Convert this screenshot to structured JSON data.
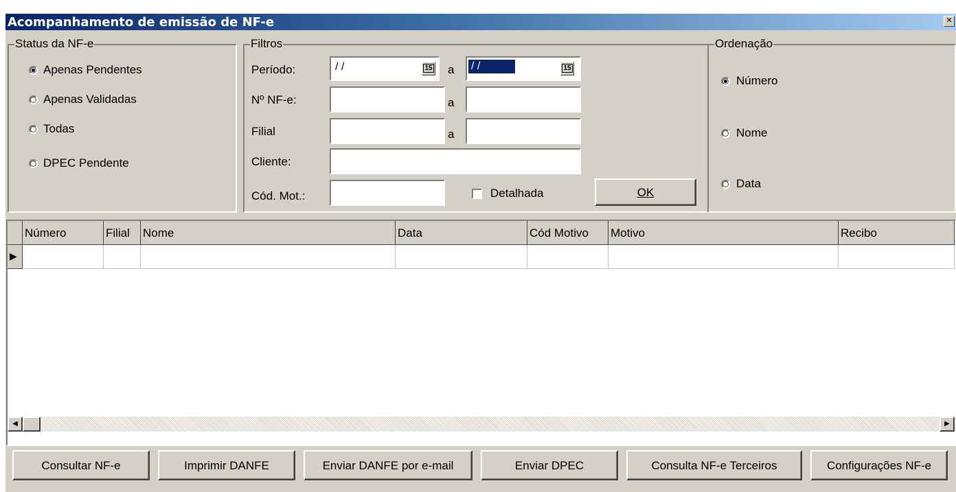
{
  "window": {
    "title": "Acompanhamento de emissão de NF-e",
    "close_glyph": "✕"
  },
  "status": {
    "legend": "Status da NF-e",
    "options": [
      {
        "label": "Apenas Pendentes",
        "selected": true
      },
      {
        "label": "Apenas Validadas",
        "selected": false
      },
      {
        "label": "Todas",
        "selected": false
      },
      {
        "label": "DPEC Pendente",
        "selected": false
      }
    ]
  },
  "filtros": {
    "legend": "Filtros",
    "periodo_label": "Período:",
    "periodo_from": "/ /",
    "periodo_to": "/ /",
    "nf_label": "Nº NF-e:",
    "filial_label": "Filial",
    "cliente_label": "Cliente:",
    "codmot_label": "Cód. Mot.:",
    "sep_a": "a",
    "calendar_glyph": "15",
    "detalhada_label": "Detalhada",
    "ok_label": "OK"
  },
  "ordenacao": {
    "legend": "Ordenação",
    "options": [
      {
        "label": "Número",
        "selected": true
      },
      {
        "label": "Nome",
        "selected": false
      },
      {
        "label": "Data",
        "selected": false
      }
    ]
  },
  "grid": {
    "columns": [
      "Número",
      "Filial",
      "Nome",
      "Data",
      "Cód Motivo",
      "Motivo",
      "Recibo"
    ],
    "row_indicator": "▶",
    "scroll_left": "◀",
    "scroll_right": "▶"
  },
  "buttons": [
    "Consultar NF-e",
    "Imprimir DANFE",
    "Enviar DANFE por e-mail",
    "Enviar DPEC",
    "Consulta NF-e Terceiros",
    "Configurações NF-e"
  ]
}
